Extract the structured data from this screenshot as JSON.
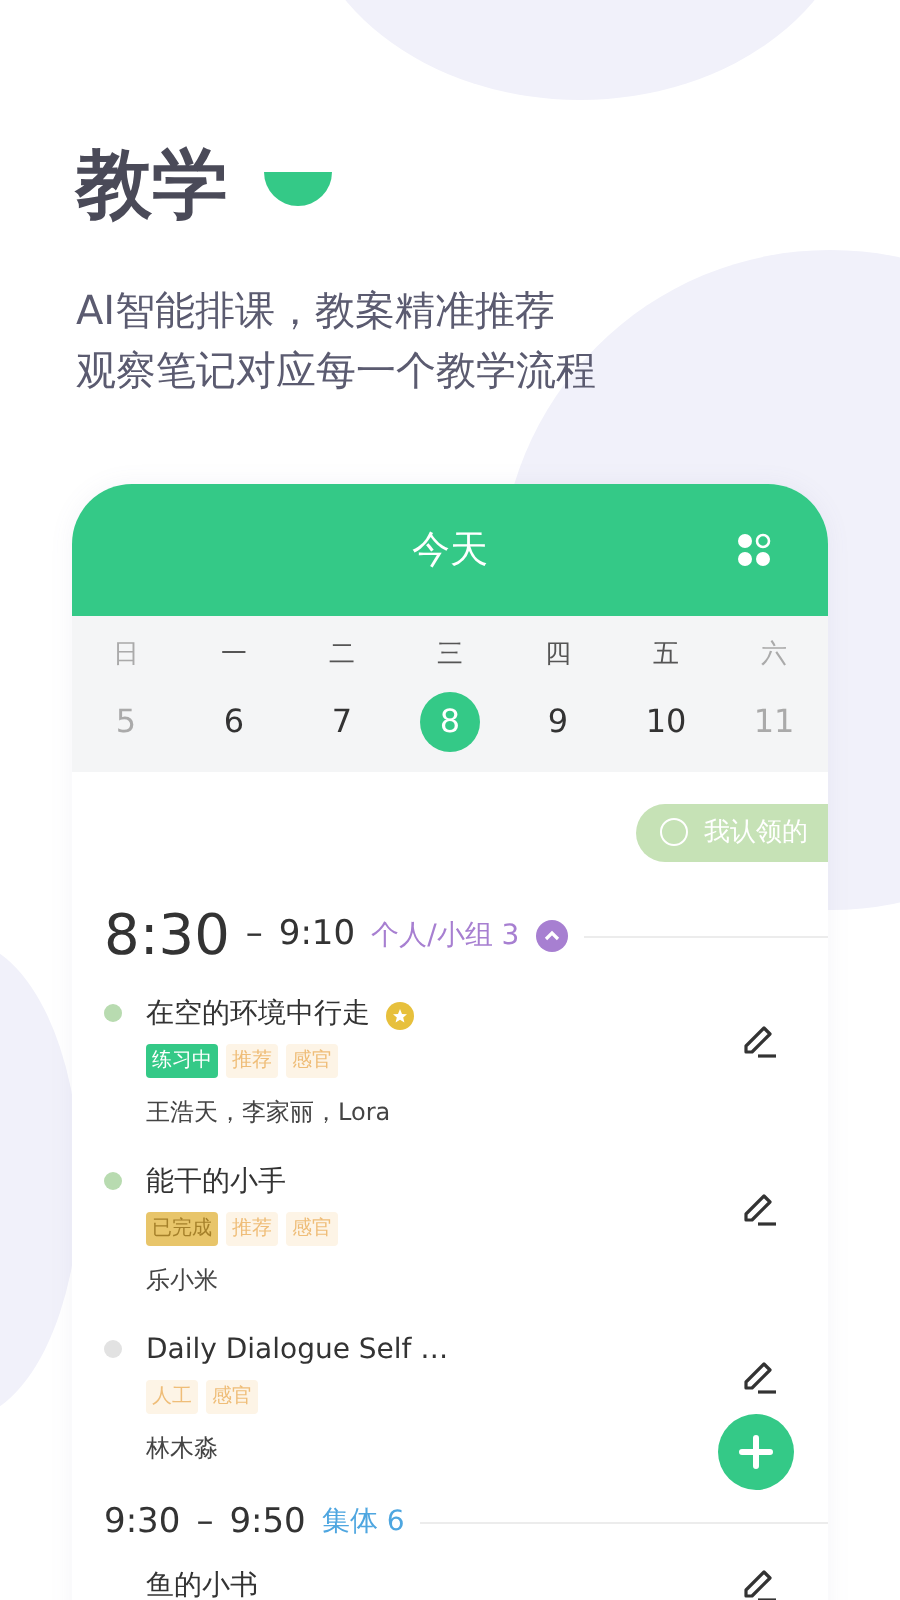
{
  "heading": {
    "title": "教学",
    "lines": [
      "AI智能排课，教案精准推荐",
      "观察笔记对应每一个教学流程"
    ]
  },
  "app": {
    "title": "今天",
    "days": [
      {
        "weekday": "日",
        "date": "5",
        "selected": false,
        "muted": true
      },
      {
        "weekday": "一",
        "date": "6",
        "selected": false,
        "muted": false
      },
      {
        "weekday": "二",
        "date": "7",
        "selected": false,
        "muted": false
      },
      {
        "weekday": "三",
        "date": "8",
        "selected": true,
        "muted": false
      },
      {
        "weekday": "四",
        "date": "9",
        "selected": false,
        "muted": false
      },
      {
        "weekday": "五",
        "date": "10",
        "selected": false,
        "muted": false
      },
      {
        "weekday": "六",
        "date": "11",
        "selected": false,
        "muted": true
      }
    ],
    "filter": {
      "label": "我认领的",
      "checked": false
    },
    "sessions": [
      {
        "kind": "current",
        "start": "8:30",
        "separator": "–",
        "end": "9:10",
        "group": "个人/小组 3",
        "color": "#a77fd1",
        "expanded": true,
        "activities": [
          {
            "title": "在空的环境中行走",
            "starred": true,
            "color": "#b8dbb0",
            "tags": [
              {
                "text": "练习中",
                "kind": "active"
              },
              {
                "text": "推荐",
                "kind": "label"
              },
              {
                "text": "感官",
                "kind": "label"
              }
            ],
            "students": "王浩天，李家丽，Lora"
          },
          {
            "title": "能干的小手",
            "starred": false,
            "color": "#b8dbb0",
            "tags": [
              {
                "text": "已完成",
                "kind": "done"
              },
              {
                "text": "推荐",
                "kind": "label"
              },
              {
                "text": "感官",
                "kind": "label"
              }
            ],
            "students": "乐小米"
          },
          {
            "title": "Daily Dialogue Self …",
            "starred": false,
            "color": "#e2e2e2",
            "tags": [
              {
                "text": "人工",
                "kind": "label"
              },
              {
                "text": "感官",
                "kind": "label"
              }
            ],
            "students": "林木淼"
          }
        ]
      },
      {
        "kind": "upcoming",
        "start": "9:30",
        "separator": "–",
        "end": "9:50",
        "group": "集体 6",
        "color": "#4ea6e0",
        "expanded": false,
        "activities": [
          {
            "title": "鱼的小书",
            "starred": false
          }
        ]
      }
    ]
  }
}
